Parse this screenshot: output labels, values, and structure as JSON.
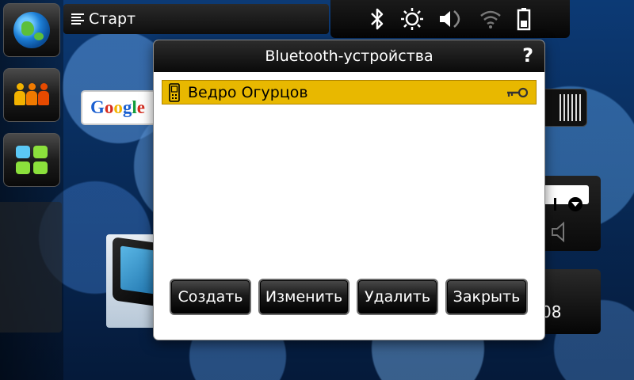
{
  "topbar": {
    "title": "Старт"
  },
  "status": {
    "icons": [
      "bluetooth-icon",
      "brightness-icon",
      "volume-icon",
      "wifi-icon",
      "battery-icon"
    ]
  },
  "launcher": {
    "items": [
      "web-browser-icon",
      "contacts-icon",
      "applications-icon"
    ]
  },
  "widgets": {
    "google_logo": "Google",
    "right_partial_text": "08"
  },
  "dialog": {
    "title": "Bluetooth-устройства",
    "help": "?",
    "devices": [
      {
        "name": "Ведро Огурцов",
        "paired": true,
        "selected": true
      }
    ],
    "buttons": {
      "create": "Создать",
      "edit": "Изменить",
      "delete": "Удалить",
      "close": "Закрыть"
    }
  },
  "colors": {
    "selection": "#e8b800",
    "dialog_header": "#0a0a0a",
    "desktop": "#0c3a75"
  }
}
